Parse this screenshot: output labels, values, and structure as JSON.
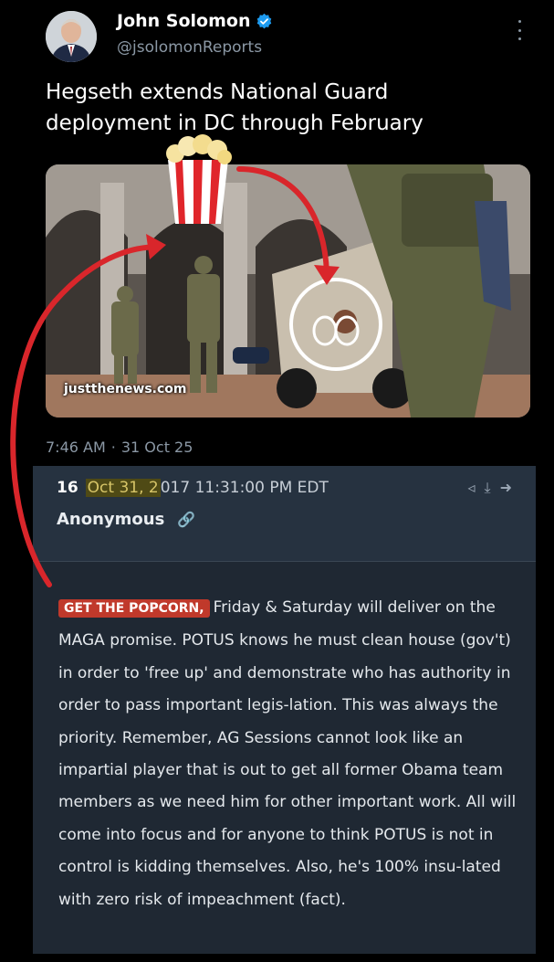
{
  "tweet": {
    "author_name": "John Solomon",
    "handle": "@jsolomonReports",
    "text": "Hegseth extends National Guard deployment in DC through February",
    "media_source": "justthenews.com",
    "time": "7:46 AM",
    "separator": "·",
    "date": "31 Oct 25"
  },
  "post": {
    "number": "16",
    "date_highlight": "Oct 31, 2",
    "date_rest": "017 11:31:00 PM EDT",
    "author": "Anonymous",
    "badge": "GET THE POPCORN,",
    "body": "Friday & Saturday will deliver on the MAGA promise. POTUS knows he must clean house (gov't) in order to 'free up' and demonstrate who has authority in order to pass important legis-lation. This was always the priority. Remember, AG Sessions cannot look like an impartial player that is out to get all former Obama team members as we need him for other important work. All will come into focus and for anyone to think POTUS is not in control is kidding themselves. Also, he's 100% insu-lated with zero risk of impeachment (fact)."
  },
  "icons": [
    "verified-badge-icon",
    "more-options-icon",
    "share-icon",
    "download-icon",
    "reply-arrow-icon",
    "link-icon",
    "popcorn-icon",
    "handcuffs-circle-icon"
  ],
  "colors": {
    "background": "#000000",
    "post_panel": "#1f2833",
    "post_header": "#263240",
    "badge_red": "#c0392b",
    "highlight": "#4f4a15",
    "arrow_red": "#d9262b",
    "link_blue": "#3d8bd9",
    "verified_blue": "#1d9bf0"
  }
}
